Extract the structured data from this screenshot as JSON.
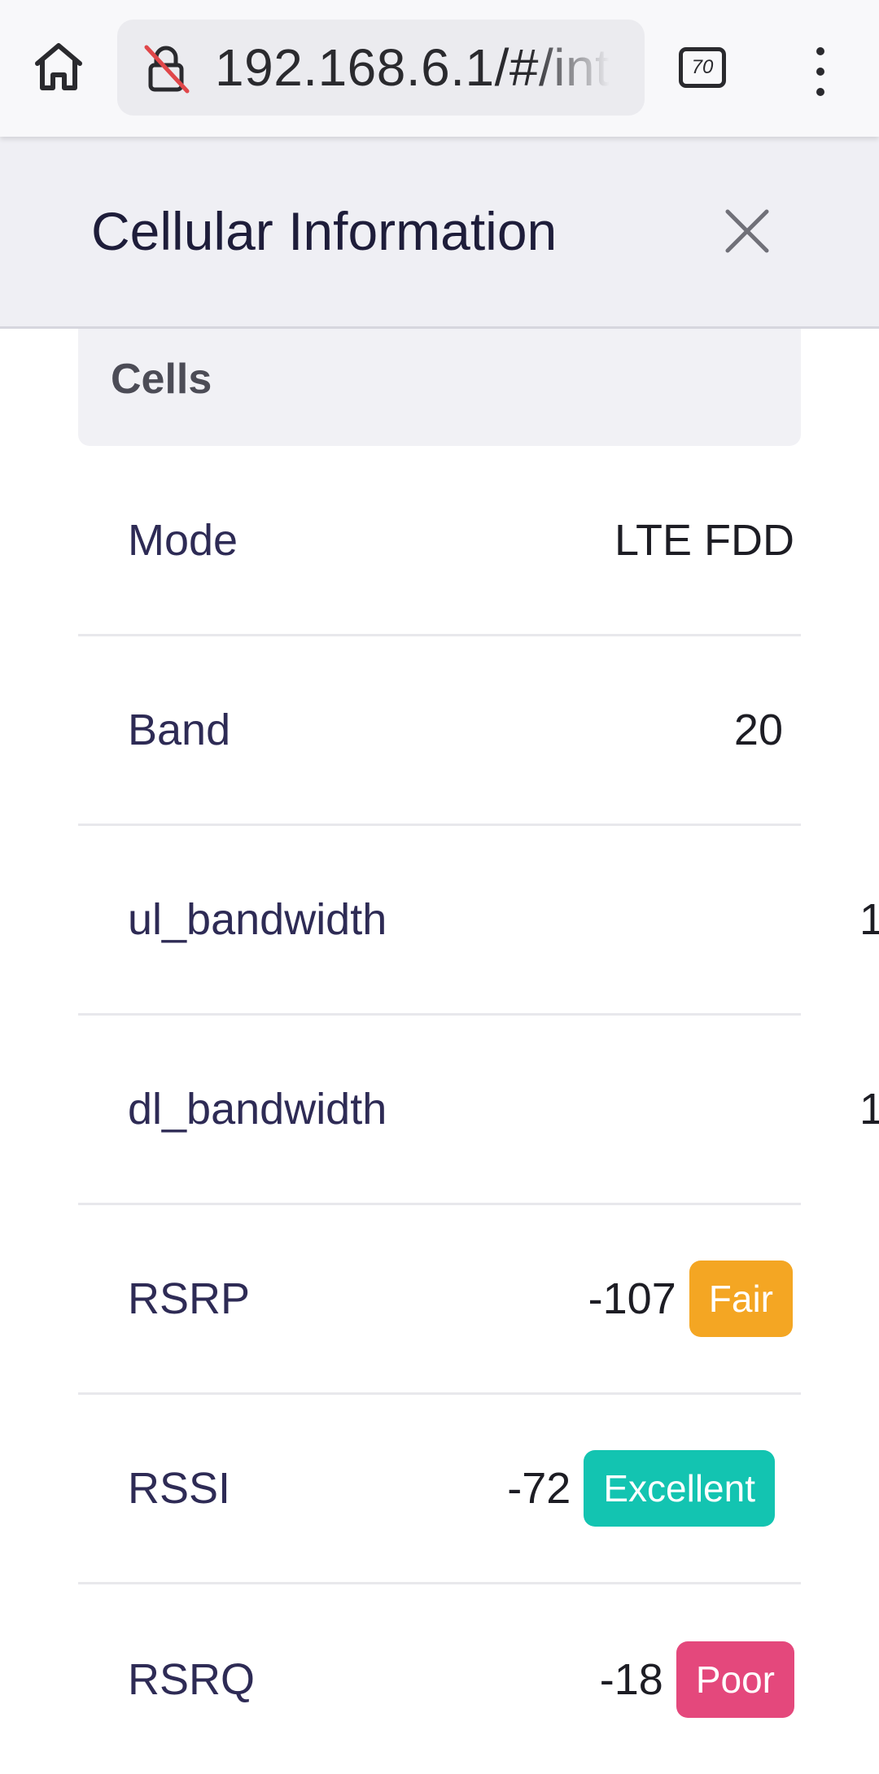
{
  "browser": {
    "url": "192.168.6.1/#/int",
    "tab_count": "70",
    "icons": {
      "home": "home-icon",
      "lock": "insecure-lock-icon",
      "menu": "more-vertical-icon"
    }
  },
  "modal": {
    "title": "Cellular Information",
    "close_icon": "close-icon",
    "section_title": "Cells"
  },
  "rows": [
    {
      "label": "Mode",
      "value": "LTE FDD",
      "badge": null
    },
    {
      "label": "Band",
      "value": "20",
      "badge": null
    },
    {
      "label": "ul_bandwidth",
      "value": "1",
      "badge": null
    },
    {
      "label": "dl_bandwidth",
      "value": "1",
      "badge": null
    },
    {
      "label": "RSRP",
      "value": "-107",
      "badge": "Fair",
      "badge_color": "#f4a623"
    },
    {
      "label": "RSSI",
      "value": "-72",
      "badge": "Excellent",
      "badge_color": "#13c4b1"
    },
    {
      "label": "RSRQ",
      "value": "-18",
      "badge": "Poor",
      "badge_color": "#e4487c"
    }
  ]
}
